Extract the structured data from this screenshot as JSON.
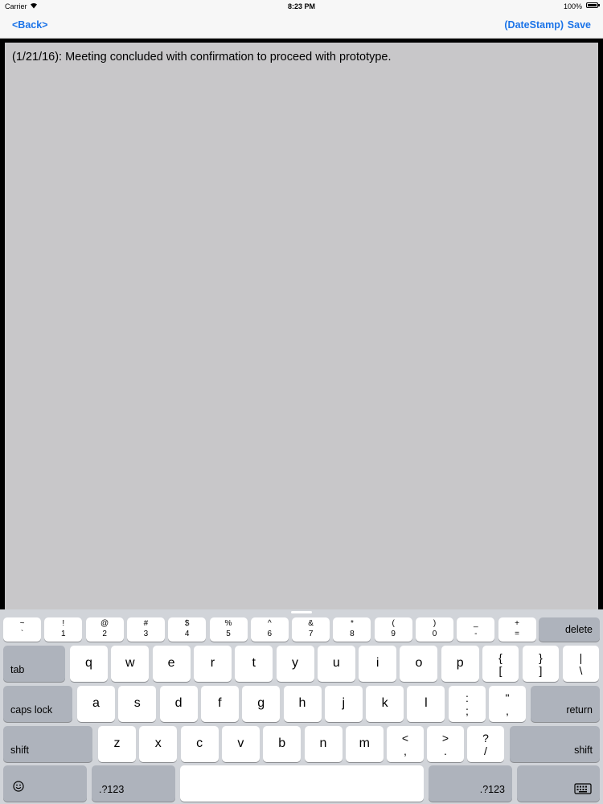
{
  "status_bar": {
    "carrier": "Carrier",
    "time": "8:23 PM",
    "battery": "100%"
  },
  "nav": {
    "back": "<Back>",
    "datestamp": "(DateStamp)",
    "save": "Save"
  },
  "note": {
    "text": "(1/21/16): Meeting concluded with confirmation to proceed with prototype."
  },
  "keyboard": {
    "row1": [
      {
        "top": "~",
        "bottom": "`"
      },
      {
        "top": "!",
        "bottom": "1"
      },
      {
        "top": "@",
        "bottom": "2"
      },
      {
        "top": "#",
        "bottom": "3"
      },
      {
        "top": "$",
        "bottom": "4"
      },
      {
        "top": "%",
        "bottom": "5"
      },
      {
        "top": "^",
        "bottom": "6"
      },
      {
        "top": "&",
        "bottom": "7"
      },
      {
        "top": "*",
        "bottom": "8"
      },
      {
        "top": "(",
        "bottom": "9"
      },
      {
        "top": ")",
        "bottom": "0"
      },
      {
        "top": "_",
        "bottom": "-"
      },
      {
        "top": "+",
        "bottom": "="
      }
    ],
    "delete": "delete",
    "tab": "tab",
    "row2": [
      "q",
      "w",
      "e",
      "r",
      "t",
      "y",
      "u",
      "i",
      "o",
      "p"
    ],
    "row2_punct": [
      {
        "top": "{",
        "bottom": "["
      },
      {
        "top": "}",
        "bottom": "]"
      },
      {
        "top": "|",
        "bottom": "\\"
      }
    ],
    "caps_lock": "caps lock",
    "row3": [
      "a",
      "s",
      "d",
      "f",
      "g",
      "h",
      "j",
      "k",
      "l"
    ],
    "row3_punct": [
      {
        "top": ":",
        "bottom": ";"
      },
      {
        "top": "\"",
        "bottom": ","
      }
    ],
    "return": "return",
    "shift_left": "shift",
    "row4": [
      "z",
      "x",
      "c",
      "v",
      "b",
      "n",
      "m"
    ],
    "row4_punct": [
      {
        "top": "<",
        "bottom": ","
      },
      {
        "top": ">",
        "bottom": "."
      },
      {
        "top": "?",
        "bottom": "/"
      }
    ],
    "shift_right": "shift",
    "numbers_left": ".?123",
    "numbers_right": ".?123",
    "emoji_icon": "emoji-icon",
    "dismiss_icon": "keyboard-dismiss-icon"
  }
}
